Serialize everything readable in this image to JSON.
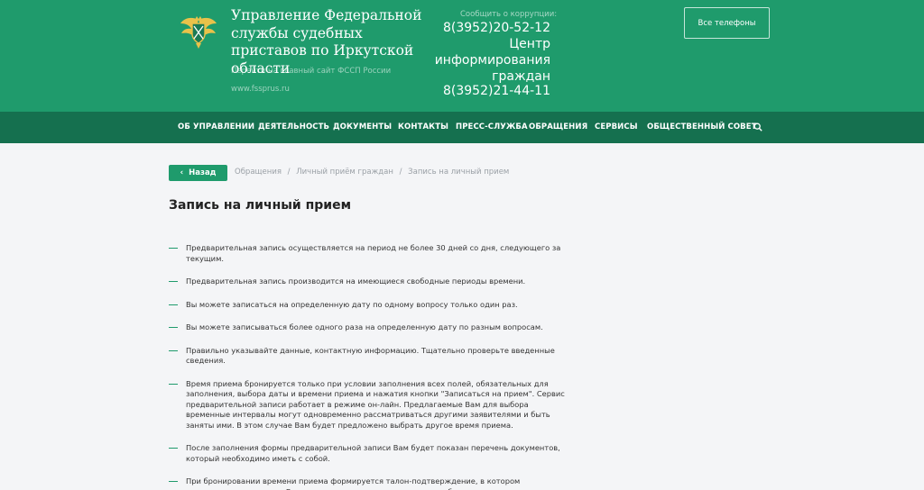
{
  "header": {
    "org_title": "Управление Федеральной службы судебных приставов по Иркутской области",
    "main_site_link": "Перейти на главный сайт ФССП России",
    "site_url": "www.fssprus.ru",
    "report_label": "Сообщить о коррупции:",
    "phone_corruption": "8(3952)20-52-12",
    "center_line1": "Центр",
    "center_line2": "информирования",
    "center_line3": "граждан",
    "phone_center": "8(3952)21-44-11",
    "all_phones_label": "Все телефоны",
    "emblem_icon": "fssp-emblem-icon"
  },
  "nav": {
    "items": [
      {
        "label": "ОБ УПРАВЛЕНИИ"
      },
      {
        "label": "ДЕЯТЕЛЬНОСТЬ"
      },
      {
        "label": "ДОКУМЕНТЫ"
      },
      {
        "label": "КОНТАКТЫ"
      },
      {
        "label": "ПРЕСС-СЛУЖБА"
      },
      {
        "label": "ОБРАЩЕНИЯ"
      },
      {
        "label": "СЕРВИСЫ"
      },
      {
        "label": "ОБЩЕСТВЕННЫЙ СОВЕТ"
      }
    ],
    "search_icon": "search-icon"
  },
  "content": {
    "back_label": "Назад",
    "breadcrumb": [
      "Обращения",
      "Личный приём граждан",
      "Запись на личный прием"
    ],
    "breadcrumb_separator": "/",
    "title": "Запись на личный прием",
    "rules": [
      "Предварительная запись осуществляется на период не более 30 дней со дня, следующего за текущим.",
      "Предварительная запись производится на имеющиеся свободные периоды времени.",
      "Вы можете записаться на определенную дату по одному вопросу только один раз.",
      "Вы можете записываться более одного раза на определенную дату по разным вопросам.",
      "Правильно указывайте данные, контактную информацию. Тщательно проверьте введенные сведения.",
      "Время приема бронируется только при условии заполнения всех полей, обязательных для заполнения, выбора даты и времени приема и нажатия кнопки \"Записаться на прием\". Сервис предварительной записи работает в режиме он-лайн. Предлагаемые Вам для выбора временные интервалы могут одновременно рассматриваться другими заявителями и быть заняты ими. В этом случае Вам будет предложено выбрать другое время приема.",
      "После заполнения формы предварительной записи Вам будет показан перечень документов, который необходимо иметь с собой.",
      "При бронировании времени приема формируется талон-подтверждение, в котором указываются введенные Вами сведения, дата, время и причина обращения."
    ]
  },
  "colors": {
    "header_green": "#1f9b6c",
    "nav_green": "#15704f",
    "background": "#f4f5f7",
    "accent": "#1f9b6c"
  }
}
